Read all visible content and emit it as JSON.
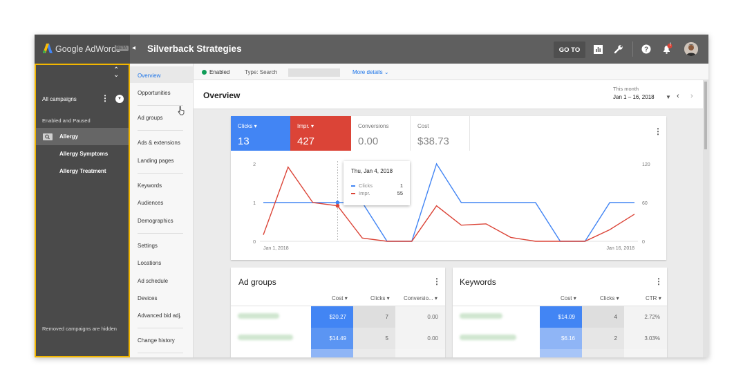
{
  "topbar": {
    "brand": "Google AdWords",
    "beta": "BETA",
    "account": "Silverback Strategies",
    "goto": "GO TO",
    "icons": [
      "reports-icon",
      "tools-icon",
      "help-icon",
      "notifications-icon"
    ],
    "notif_badge": "!"
  },
  "campaigns": {
    "all": "All campaigns",
    "filter": "Enabled and Paused",
    "items": [
      "Allergy",
      "Allergy Symptoms",
      "Allergy Treatment"
    ],
    "footer": "Removed campaigns are hidden"
  },
  "nav": {
    "items": [
      "Overview",
      "Opportunities",
      "Ad groups",
      "Ads & extensions",
      "Landing pages",
      "Keywords",
      "Audiences",
      "Demographics",
      "Settings",
      "Locations",
      "Ad schedule",
      "Devices",
      "Advanced bid adj.",
      "Change history"
    ]
  },
  "status": {
    "state": "Enabled",
    "type": "Type: Search",
    "more": "More details"
  },
  "overview": {
    "title": "Overview",
    "range_label": "This month",
    "range": "Jan 1 – 16, 2018"
  },
  "metrics": [
    {
      "label": "Clicks",
      "value": "13",
      "color": "#4285f4"
    },
    {
      "label": "Impr.",
      "value": "427",
      "color": "#db4437"
    },
    {
      "label": "Conversions",
      "value": "0.00"
    },
    {
      "label": "Cost",
      "value": "$38.73"
    }
  ],
  "chart": {
    "left_ticks": [
      "2",
      "1",
      "0"
    ],
    "right_ticks": [
      "120",
      "60",
      "0"
    ],
    "x_start": "Jan 1, 2018",
    "x_end": "Jan 16, 2018",
    "tooltip": {
      "date": "Thu, Jan 4, 2018",
      "clicks_label": "Clicks",
      "clicks": "1",
      "impr_label": "Impr.",
      "impr": "55"
    }
  },
  "chart_data": {
    "type": "line",
    "x": [
      "Jan 1",
      "Jan 2",
      "Jan 3",
      "Jan 4",
      "Jan 5",
      "Jan 6",
      "Jan 7",
      "Jan 8",
      "Jan 9",
      "Jan 10",
      "Jan 11",
      "Jan 12",
      "Jan 13",
      "Jan 14",
      "Jan 15",
      "Jan 16"
    ],
    "series": [
      {
        "name": "Clicks",
        "axis": "left",
        "color": "#4285f4",
        "values": [
          1,
          1,
          1,
          1,
          1,
          0,
          0,
          2,
          1,
          1,
          1,
          1,
          0,
          0,
          1,
          1
        ]
      },
      {
        "name": "Impr.",
        "axis": "right",
        "color": "#db4437",
        "values": [
          10,
          115,
          60,
          55,
          5,
          0,
          0,
          55,
          25,
          27,
          6,
          0,
          0,
          0,
          18,
          42
        ]
      }
    ],
    "ylim_left": [
      0,
      2
    ],
    "ylim_right": [
      0,
      120
    ]
  },
  "adgroups": {
    "title": "Ad groups",
    "headers": [
      "Cost",
      "Clicks",
      "Conversio..."
    ],
    "rows": [
      [
        "$20.27",
        "7",
        "0.00"
      ],
      [
        "$14.49",
        "5",
        "0.00"
      ]
    ]
  },
  "keywords": {
    "title": "Keywords",
    "headers": [
      "Cost",
      "Clicks",
      "CTR"
    ],
    "rows": [
      [
        "$14.09",
        "4",
        "2.72%"
      ],
      [
        "$6.16",
        "2",
        "3.03%"
      ]
    ]
  }
}
